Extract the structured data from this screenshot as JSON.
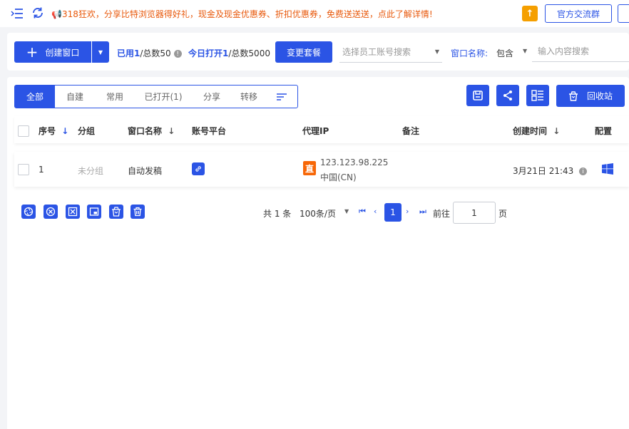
{
  "topbar": {
    "notice": "📢318狂欢，分享比特浏览器得好礼，现金及现金优惠券、折扣优惠券，免费送送送，点此了解详情!",
    "group_button": "官方交流群",
    "upload_icon": "arrow-up-icon"
  },
  "toolbar": {
    "create_label": "创建窗口",
    "used_label": "已用",
    "used_count": "1",
    "used_total": "/总数50",
    "today_label": "今日打开",
    "today_count": "1",
    "today_total": "/总数5000",
    "change_plan": "变更套餐",
    "staff_placeholder": "选择员工账号搜索",
    "window_name_label": "窗口名称:",
    "match_mode": "包含",
    "search_placeholder": "输入内容搜索"
  },
  "tabs": [
    {
      "label": "全部",
      "active": true
    },
    {
      "label": "自建"
    },
    {
      "label": "常用"
    },
    {
      "label": "已打开(1)"
    },
    {
      "label": "分享"
    },
    {
      "label": "转移"
    }
  ],
  "actions": {
    "recycle": "回收站"
  },
  "table": {
    "headers": {
      "index": "序号",
      "group": "分组",
      "name": "窗口名称",
      "platform": "账号平台",
      "proxy": "代理IP",
      "note": "备注",
      "created": "创建时间",
      "config": "配置"
    },
    "rows": [
      {
        "index": "1",
        "group": "未分组",
        "name": "自动发稿",
        "proxy_tag": "直",
        "proxy_ip": "123.123.98.225",
        "proxy_region": "中国(CN)",
        "created": "3月21日 21:43",
        "os_icon": "windows-icon"
      }
    ]
  },
  "pagination": {
    "total": "共 1 条",
    "page_size": "100条/页",
    "current": "1",
    "goto_label": "前往",
    "goto_value": "1",
    "suffix": "页"
  },
  "colors": {
    "primary": "#2b54e5",
    "notice": "#e8590c",
    "upload": "#f59f00",
    "direct_tag": "#f76707"
  }
}
